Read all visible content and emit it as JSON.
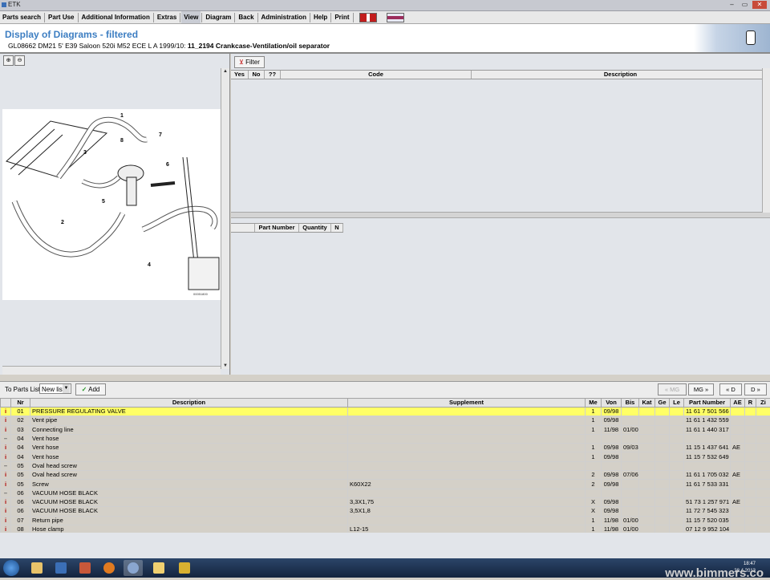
{
  "window": {
    "title": "ETK"
  },
  "menu": [
    "Parts search",
    "Part Use",
    "Additional Information",
    "Extras",
    "View",
    "Diagram",
    "Back",
    "Administration",
    "Help",
    "Print"
  ],
  "header": {
    "title": "Display of Diagrams - filtered",
    "crumb_prefix": "GL08662 DM21 5' E39 Saloon 520i M52 ECE L A 1999/10: ",
    "crumb_bold": "11_2194 Crankcase-Ventilation/oil separator"
  },
  "diagram": {
    "callouts": [
      "1",
      "2",
      "3",
      "4",
      "5",
      "6",
      "7",
      "8"
    ],
    "image_number": "00051800"
  },
  "filter": {
    "label": "Filter"
  },
  "upper_grid": {
    "columns": [
      "Yes",
      "No",
      "??",
      "Code",
      "Description"
    ]
  },
  "lower_grid": {
    "columns": [
      "",
      "Part Number",
      "Quantity",
      "N"
    ]
  },
  "parts_list": {
    "label": "To Parts List",
    "list_value": "New list",
    "add_label": "Add",
    "nav": [
      "« MG",
      "MG »",
      "« D",
      "D »"
    ]
  },
  "parts_table": {
    "columns": [
      "",
      "Nr",
      "Description",
      "Supplement",
      "Me",
      "Von",
      "Bis",
      "Kat",
      "Ge",
      "Le",
      "Part Number",
      "AE",
      "R",
      "Zi"
    ],
    "rows": [
      {
        "icon": "i",
        "nr": "01",
        "desc": "PRESSURE REGULATING VALVE",
        "supp": "",
        "me": "1",
        "von": "09/98",
        "bis": "",
        "pn": "11 61 7 501 566",
        "ae": "",
        "hl": true
      },
      {
        "icon": "i",
        "nr": "02",
        "desc": "Vent pipe",
        "supp": "",
        "me": "1",
        "von": "09/98",
        "bis": "",
        "pn": "11 61 1 432 559",
        "ae": ""
      },
      {
        "icon": "i",
        "nr": "03",
        "desc": "Connecting line",
        "supp": "",
        "me": "1",
        "von": "11/98",
        "bis": "01/00",
        "pn": "11 61 1 440 317",
        "ae": ""
      },
      {
        "icon": "–",
        "nr": "04",
        "desc": "Vent hose",
        "supp": "",
        "me": "",
        "von": "",
        "bis": "",
        "pn": "",
        "ae": ""
      },
      {
        "icon": "i",
        "nr": "04",
        "desc": "Vent hose",
        "supp": "",
        "me": "1",
        "von": "09/98",
        "bis": "09/03",
        "pn": "11 15 1 437 641",
        "ae": "AE"
      },
      {
        "icon": "i",
        "nr": "04",
        "desc": "Vent hose",
        "supp": "",
        "me": "1",
        "von": "09/98",
        "bis": "",
        "pn": "11 15 7 532 649",
        "ae": ""
      },
      {
        "icon": "–",
        "nr": "05",
        "desc": "Oval head screw",
        "supp": "",
        "me": "",
        "von": "",
        "bis": "",
        "pn": "",
        "ae": ""
      },
      {
        "icon": "i",
        "nr": "05",
        "desc": "Oval head screw",
        "supp": "",
        "me": "2",
        "von": "09/98",
        "bis": "07/06",
        "pn": "11 61 1 705 032",
        "ae": "AE"
      },
      {
        "icon": "i",
        "nr": "05",
        "desc": "Screw",
        "supp": "K60X22",
        "me": "2",
        "von": "09/98",
        "bis": "",
        "pn": "11 61 7 533 331",
        "ae": ""
      },
      {
        "icon": "–",
        "nr": "06",
        "desc": "VACUUM HOSE BLACK",
        "supp": "",
        "me": "",
        "von": "",
        "bis": "",
        "pn": "",
        "ae": ""
      },
      {
        "icon": "i",
        "nr": "06",
        "desc": "VACUUM HOSE BLACK",
        "supp": "3,3X1,75",
        "me": "X",
        "von": "09/98",
        "bis": "",
        "pn": "51 73 1 257 971",
        "ae": "AE"
      },
      {
        "icon": "i",
        "nr": "06",
        "desc": "VACUUM HOSE BLACK",
        "supp": "3,5X1,8",
        "me": "X",
        "von": "09/98",
        "bis": "",
        "pn": "11 72 7 545 323",
        "ae": ""
      },
      {
        "icon": "i",
        "nr": "07",
        "desc": "Return pipe",
        "supp": "",
        "me": "1",
        "von": "11/98",
        "bis": "01/00",
        "pn": "11 15 7 520 035",
        "ae": ""
      },
      {
        "icon": "i",
        "nr": "08",
        "desc": "Hose clamp",
        "supp": "L12-15",
        "me": "1",
        "von": "11/98",
        "bis": "01/00",
        "pn": "07 12 9 952 104",
        "ae": ""
      }
    ]
  },
  "taskbar": {
    "time": "18:47",
    "date": "28.4.2013"
  },
  "watermark": "www.bimmers.co"
}
